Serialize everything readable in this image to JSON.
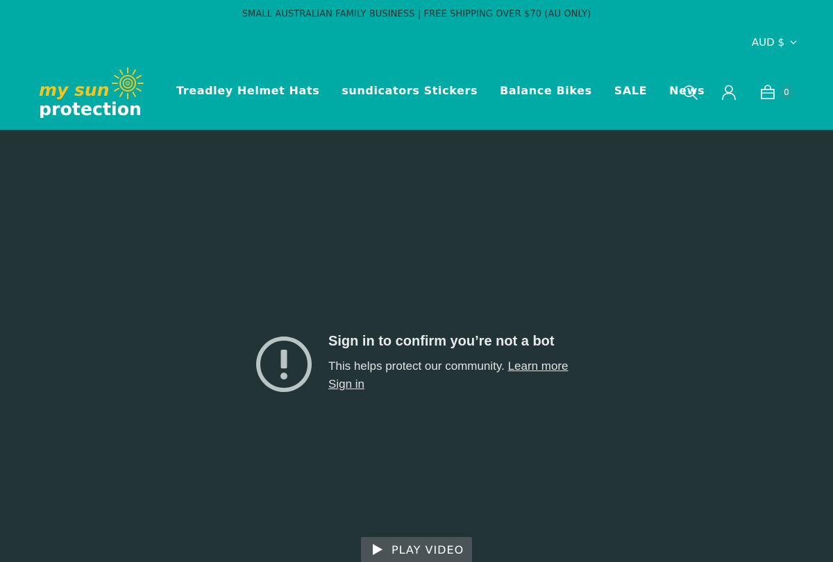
{
  "announcement": "SMALL AUSTRALIAN FAMILY BUSINESS | FREE SHIPPING OVER $70 (AU ONLY)",
  "currency": {
    "label": "AUD $",
    "icon": "chevron-down-icon"
  },
  "logo": {
    "line1": "my sun",
    "line2": "protection"
  },
  "nav": {
    "items": [
      {
        "label": "Treadley Helmet Hats"
      },
      {
        "label": "sundicators Stickers"
      },
      {
        "label": "Balance Bikes"
      },
      {
        "label": "SALE"
      },
      {
        "label": "News"
      }
    ]
  },
  "icons": {
    "search": "search-icon",
    "account": "user-icon",
    "cart": "bag-icon"
  },
  "cart": {
    "count": "0"
  },
  "video": {
    "title": "Sign in to confirm you’re not a bot",
    "body": "This helps protect our community.",
    "learn_more": "Learn more",
    "sign_in": "Sign in",
    "play_label": "PLAY VIDEO"
  },
  "colors": {
    "header_bg": "#00aba6",
    "video_bg": "#233436",
    "logo_yellow": "#f2c61f"
  }
}
